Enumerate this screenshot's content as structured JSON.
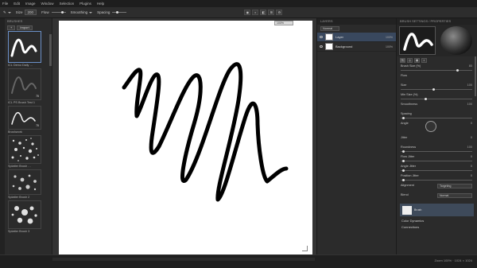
{
  "menu": [
    "File",
    "Edit",
    "Image",
    "Window",
    "Selection",
    "Plugins",
    "Help"
  ],
  "options_bar": {
    "tool_label": "Brush",
    "size_label": "Size",
    "size_value": "200",
    "flow_label": "Flow",
    "smoothing_label": "Smoothing",
    "spacing_label": "Spacing"
  },
  "brushes_panel": {
    "title": "BRUSHES",
    "buttons": [
      "+",
      "Import"
    ],
    "items": [
      {
        "label": "ICL Demo Daily …",
        "num": "",
        "selected": true
      },
      {
        "label": "ICL Outlined Brush",
        "num": "",
        "selected": false
      },
      {
        "label": "ICL PS Brush Test 1",
        "num": "75",
        "selected": false
      },
      {
        "label": "Brushwork",
        "num": "75",
        "selected": false
      },
      {
        "label": "Splatter Brush …",
        "num": "",
        "selected": false
      },
      {
        "label": "Splatter Brush 2",
        "num": "",
        "selected": false
      },
      {
        "label": "Splatter Brush 3",
        "num": "",
        "selected": false
      }
    ]
  },
  "canvas": {
    "nav_chip": "100%"
  },
  "layers_panel": {
    "title": "LAYERS",
    "blend_mode": "Normal",
    "layers": [
      {
        "name": "Layer",
        "opacity": "100%",
        "selected": true
      },
      {
        "name": "Background",
        "opacity": "100%",
        "selected": false
      }
    ]
  },
  "properties_panel": {
    "title": "BRUSH SETTINGS / PROPERTIES",
    "rows": [
      {
        "label": "Brush Size (%)",
        "value": "80"
      },
      {
        "label": "Flow",
        "value": ""
      },
      {
        "label": "Size",
        "value": "100"
      },
      {
        "label": "Min Size (%)",
        "value": ""
      },
      {
        "label": "Smoothness",
        "value": "100"
      },
      {
        "label": "Spacing",
        "value": ""
      },
      {
        "label": "Angle",
        "value": "0"
      },
      {
        "label": "Jitter",
        "value": "0"
      },
      {
        "label": "Roundness",
        "value": "100"
      },
      {
        "label": "Flow Jitter",
        "value": "0"
      },
      {
        "label": "Angle Jitter",
        "value": "0"
      },
      {
        "label": "Position Jitter",
        "value": "0"
      }
    ],
    "section_headers": [
      "Color Dynamics",
      "Connections"
    ],
    "brush_name": "Brush",
    "align_label": "Alignment",
    "align_value": "Targeting",
    "blend_label": "Blend",
    "blend_value": "Normal"
  },
  "status": {
    "text": "Zoom 100% · 1024 × 1024"
  }
}
